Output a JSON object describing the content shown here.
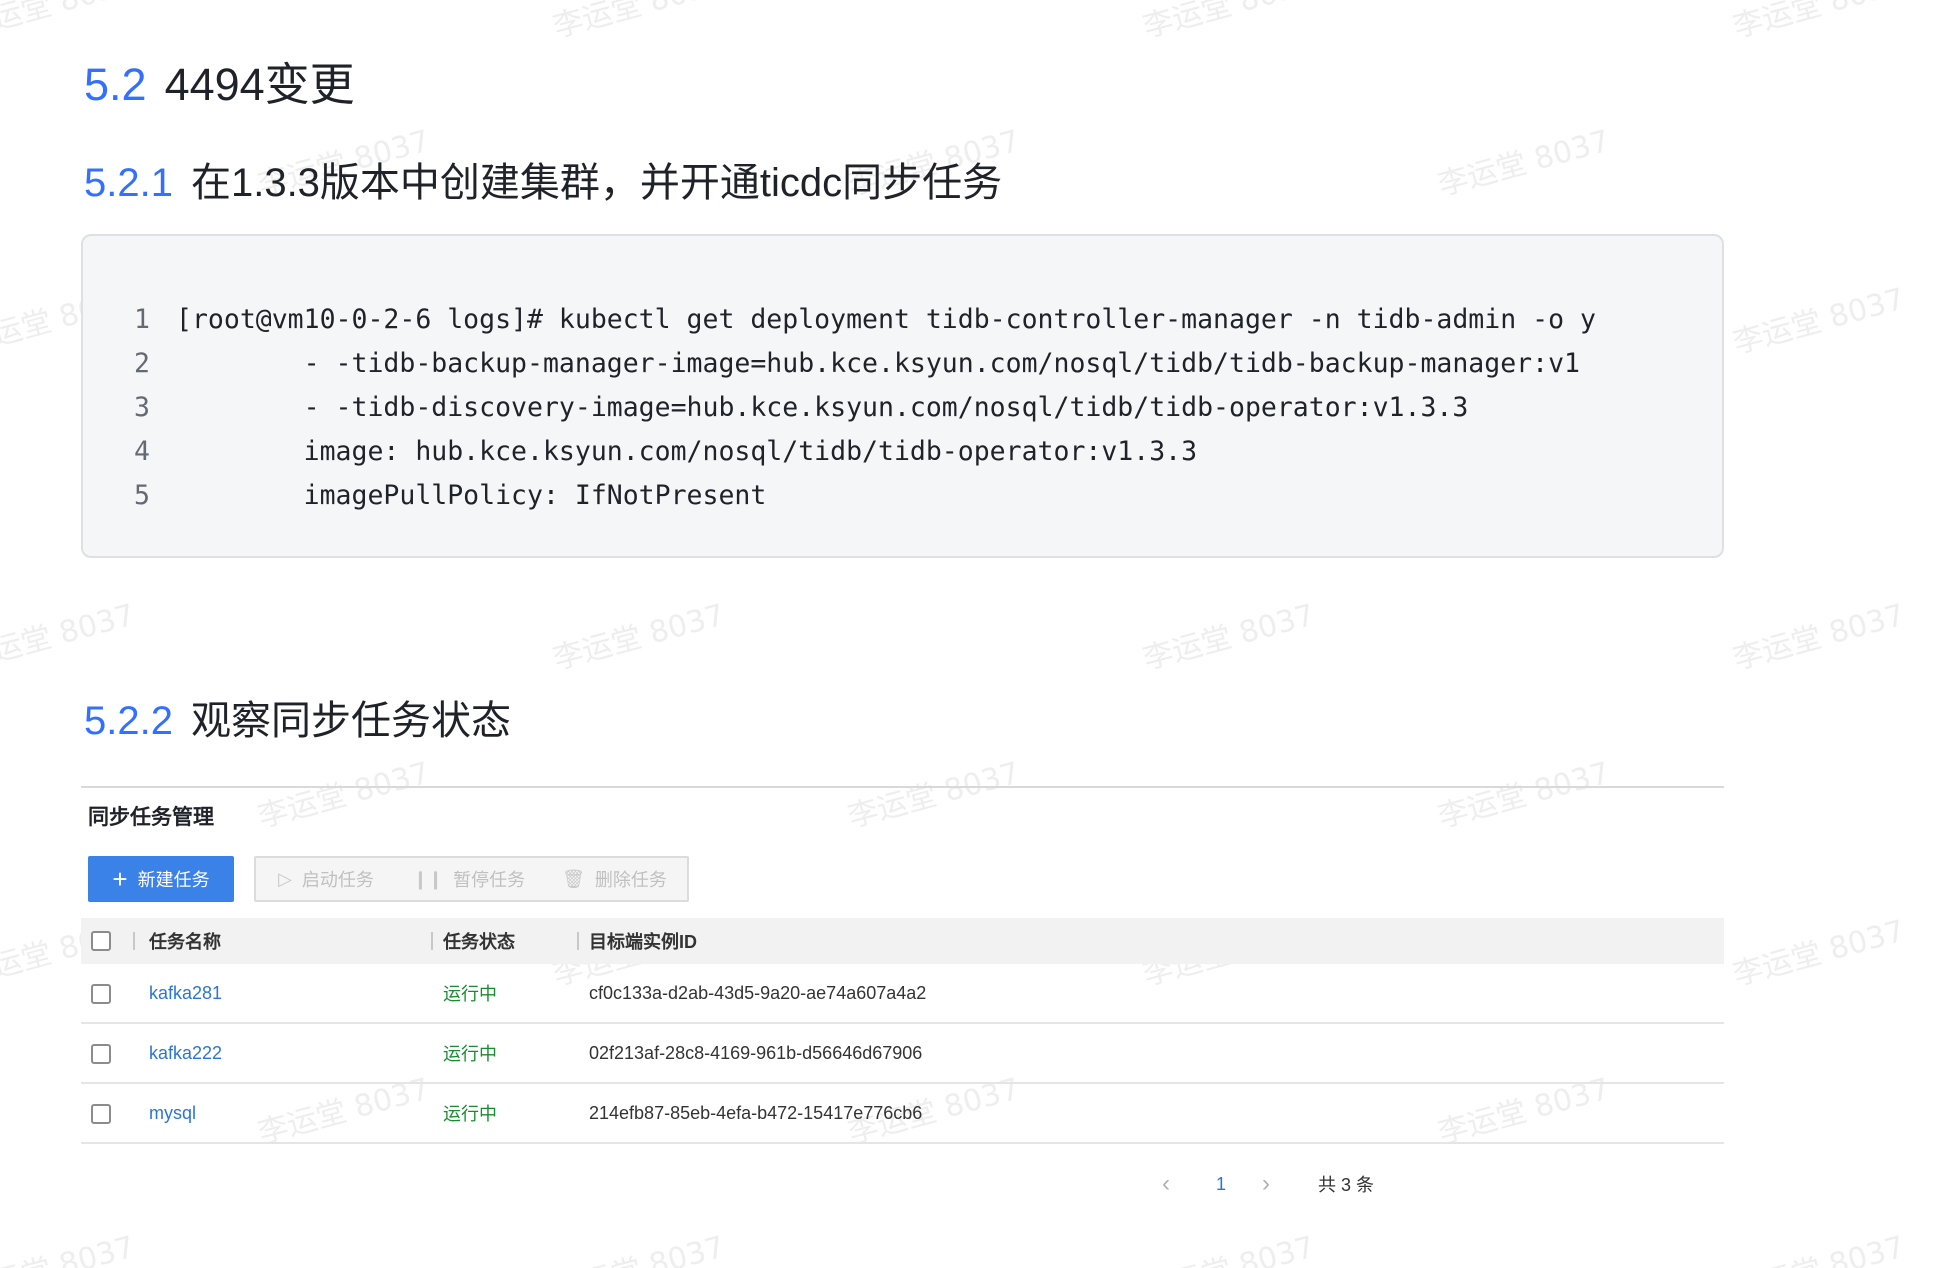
{
  "headings": {
    "h52": {
      "num": "5.2",
      "text": "4494变更"
    },
    "h521": {
      "num": "5.2.1",
      "text": "在1.3.3版本中创建集群，并开通ticdc同步任务"
    },
    "h522": {
      "num": "5.2.2",
      "text": "观察同步任务状态"
    }
  },
  "code": {
    "lines": [
      {
        "n": "1",
        "text": "[root@vm10-0-2-6 logs]# kubectl get deployment tidb-controller-manager -n tidb-admin -o y"
      },
      {
        "n": "2",
        "text": "        - -tidb-backup-manager-image=hub.kce.ksyun.com/nosql/tidb/tidb-backup-manager:v1"
      },
      {
        "n": "3",
        "text": "        - -tidb-discovery-image=hub.kce.ksyun.com/nosql/tidb/tidb-operator:v1.3.3"
      },
      {
        "n": "4",
        "text": "        image: hub.kce.ksyun.com/nosql/tidb/tidb-operator:v1.3.3"
      },
      {
        "n": "5",
        "text": "        imagePullPolicy: IfNotPresent"
      }
    ]
  },
  "panel": {
    "title": "同步任务管理",
    "buttons": {
      "new": "新建任务",
      "start": "启动任务",
      "pause": "暂停任务",
      "delete": "删除任务"
    },
    "table": {
      "headers": {
        "name": "任务名称",
        "status": "任务状态",
        "id": "目标端实例ID"
      },
      "rows": [
        {
          "name": "kafka281",
          "status": "运行中",
          "id": "cf0c133a-d2ab-43d5-9a20-ae74a607a4a2"
        },
        {
          "name": "kafka222",
          "status": "运行中",
          "id": "02f213af-28c8-4169-961b-d56646d67906"
        },
        {
          "name": "mysql",
          "status": "运行中",
          "id": "214efb87-85eb-4efa-b472-15417e776cb6"
        }
      ]
    },
    "pager": {
      "prev": "‹",
      "current": "1",
      "next": "›",
      "total": "共 3 条"
    }
  },
  "watermark": "李运堂 8037",
  "colors": {
    "accent": "#3370ff",
    "primary_button": "#3b82e8",
    "status_running": "#1a8c30",
    "link": "#2a76d6"
  }
}
